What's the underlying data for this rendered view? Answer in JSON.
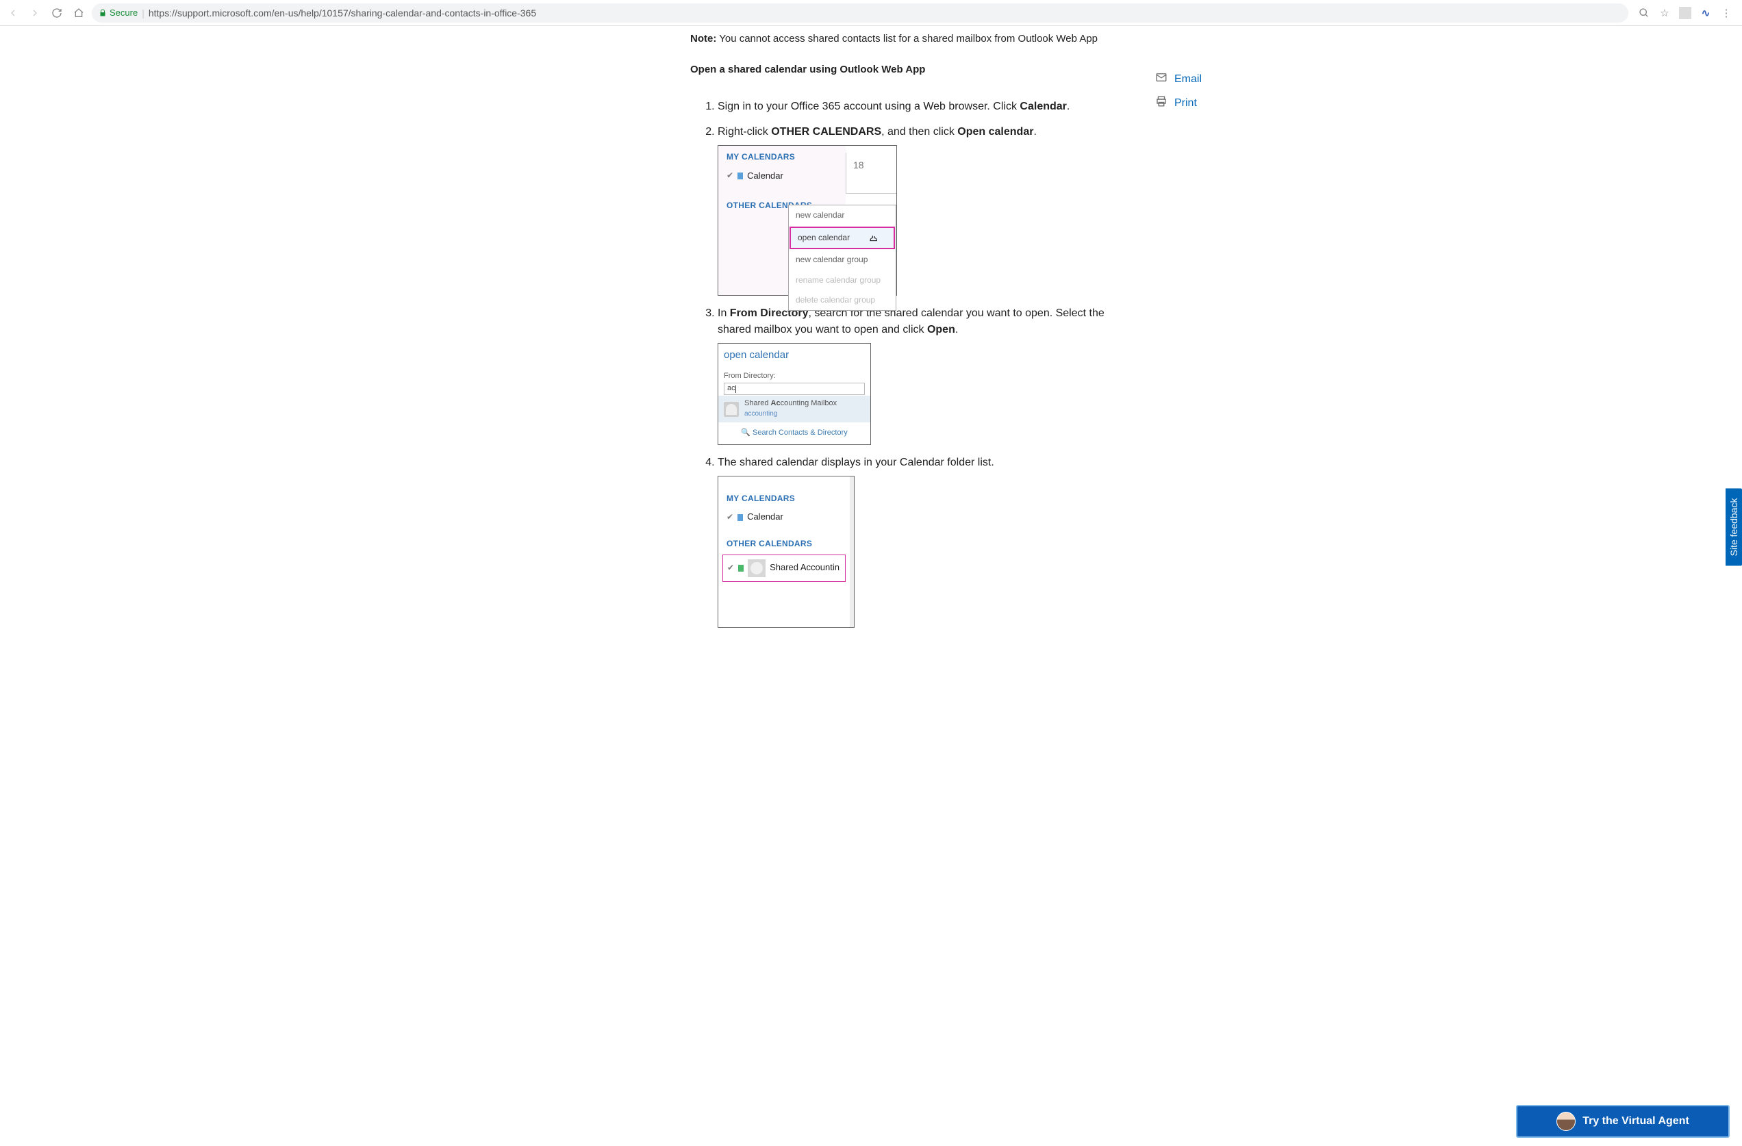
{
  "chrome": {
    "secure_label": "Secure",
    "url": "https://support.microsoft.com/en-us/help/10157/sharing-calendar-and-contacts-in-office-365"
  },
  "note": {
    "label": "Note:",
    "text": " You cannot access shared contacts list for a shared mailbox from Outlook Web App"
  },
  "section_heading": "Open a shared calendar using Outlook Web App",
  "side": {
    "email": "Email",
    "print": "Print"
  },
  "steps": {
    "s1_a": "Sign in to your Office 365 account using a Web browser. Click ",
    "s1_b": "Calendar",
    "s1_c": ".",
    "s2_a": "Right-click ",
    "s2_b": "OTHER CALENDARS",
    "s2_c": ", and then click ",
    "s2_d": "Open calendar",
    "s2_e": ".",
    "s3_a": "In ",
    "s3_b": "From Directory",
    "s3_c": ", search for the shared calendar you want to open. Select the shared mailbox you want to open and click ",
    "s3_d": "Open",
    "s3_e": ".",
    "s4": "The shared calendar displays in your Calendar folder list."
  },
  "shot1": {
    "my_calendars": "MY CALENDARS",
    "calendar": "Calendar",
    "other_calendars": "OTHER CALENDARS",
    "day": "18",
    "menu": {
      "new_calendar": "new calendar",
      "open_calendar": "open calendar",
      "new_group": "new calendar group",
      "rename_group": "rename calendar group",
      "delete_group": "delete calendar group"
    }
  },
  "shot2": {
    "title": "open calendar",
    "from_directory": "From Directory:",
    "input_value": "ac",
    "suggest_name_a": "Shared ",
    "suggest_name_b": "Ac",
    "suggest_name_c": "counting Mailbox",
    "suggest_sub": "accounting",
    "search_contacts": "Search Contacts & Directory"
  },
  "shot3": {
    "my_calendars": "MY CALENDARS",
    "calendar": "Calendar",
    "other_calendars": "OTHER CALENDARS",
    "shared_name": "Shared Accountin"
  },
  "feedback_tab": "Site feedback",
  "vagent": "Try the Virtual Agent"
}
